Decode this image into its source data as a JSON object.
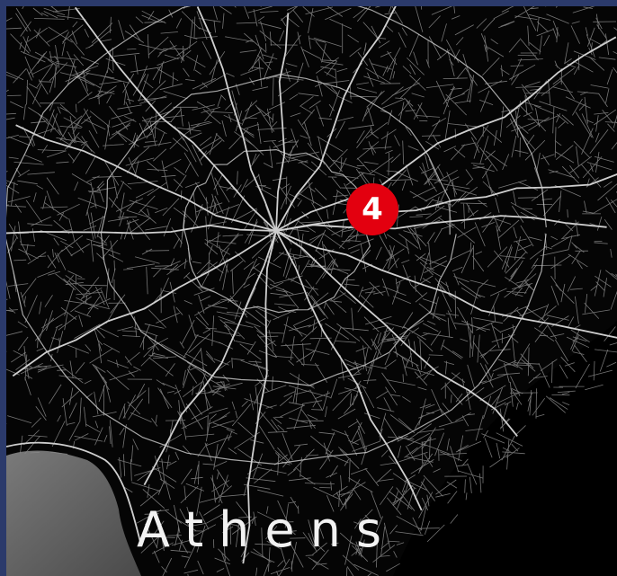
{
  "map": {
    "city_label": "Athens",
    "marker": {
      "label": "4",
      "color": "#e3000f"
    },
    "colors": {
      "frame": "#2b3a6b",
      "land": "#050505",
      "roads": "#bdbdbd",
      "sea": "#6f6f6f"
    }
  }
}
